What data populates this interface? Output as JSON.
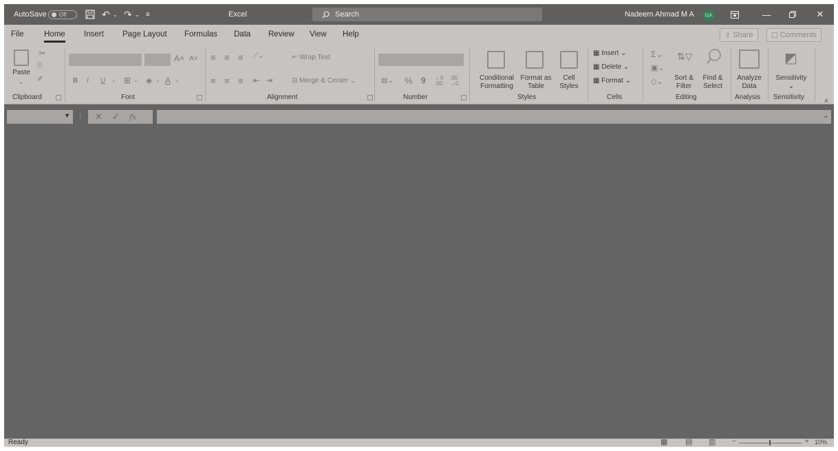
{
  "titlebar": {
    "autosave_label": "AutoSave",
    "autosave_state": "Off",
    "app_title": "Excel",
    "search_placeholder": "Search",
    "user_name": "Nadeem Ahmad M A",
    "user_initials": "NA",
    "icons": [
      "save-icon",
      "undo-icon",
      "redo-icon",
      "customize-qat-icon",
      "ribbon-display-icon",
      "minimize-icon",
      "restore-icon",
      "close-icon"
    ]
  },
  "tabs": [
    "File",
    "Home",
    "Insert",
    "Page Layout",
    "Formulas",
    "Data",
    "Review",
    "View",
    "Help"
  ],
  "active_tab": "Home",
  "share_label": "Share",
  "comments_label": "Comments",
  "ribbon": {
    "clipboard": {
      "paste": "Paste",
      "label": "Clipboard"
    },
    "font": {
      "label": "Font",
      "bold": "B",
      "italic": "I",
      "underline": "U"
    },
    "alignment": {
      "wrap_text": "Wrap Text",
      "merge_center": "Merge & Center",
      "label": "Alignment"
    },
    "number": {
      "percent": "%",
      "comma": "9",
      "label": "Number"
    },
    "styles": {
      "conditional_1": "Conditional",
      "conditional_2": "Formatting",
      "format_as_1": "Format as",
      "format_as_2": "Table",
      "cell_1": "Cell",
      "cell_2": "Styles",
      "label": "Styles"
    },
    "cells": {
      "insert": "Insert",
      "delete": "Delete",
      "format": "Format",
      "label": "Cells"
    },
    "editing": {
      "sort_1": "Sort &",
      "sort_2": "Filter",
      "find_1": "Find &",
      "find_2": "Select",
      "label": "Editing"
    },
    "analysis": {
      "analyze_1": "Analyze",
      "analyze_2": "Data",
      "label": "Analysis"
    },
    "sensitivity": {
      "button": "Sensitivity",
      "label": "Sensitivity"
    }
  },
  "formula_bar": {
    "cancel": "✕",
    "enter": "✓",
    "fx": "fx"
  },
  "status": {
    "text": "Ready",
    "zoom": "10%"
  }
}
